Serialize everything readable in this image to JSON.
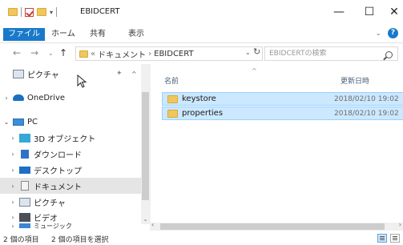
{
  "window": {
    "title": "EBIDCERT",
    "min": "—",
    "max": "☐",
    "close": "✕"
  },
  "ribbon": {
    "file": "ファイル",
    "home": "ホーム",
    "share": "共有",
    "view": "表示",
    "collapse": "⌄",
    "help": "?"
  },
  "address": {
    "back": "←",
    "forward": "→",
    "recent": "⌄",
    "up": "↑",
    "overflow": "«",
    "crumbs": [
      "ドキュメント",
      "EBIDCERT"
    ],
    "dropdown": "⌄",
    "refresh": "↻",
    "search_placeholder": "EBIDCERTの検索"
  },
  "nav": {
    "items": [
      {
        "label": "ピクチャ",
        "icon": "pictures-icon",
        "arrow": "",
        "pinned": true
      },
      {
        "label": "OneDrive",
        "icon": "onedrive-icon",
        "arrow": "›"
      },
      {
        "label": "PC",
        "icon": "pc-icon",
        "arrow": "⌄"
      },
      {
        "label": "3D オブジェクト",
        "icon": "3d-objects-icon",
        "arrow": "›"
      },
      {
        "label": "ダウンロード",
        "icon": "downloads-icon",
        "arrow": "›"
      },
      {
        "label": "デスクトップ",
        "icon": "desktop-icon",
        "arrow": "›"
      },
      {
        "label": "ドキュメント",
        "icon": "documents-icon",
        "arrow": "›",
        "selected": true
      },
      {
        "label": "ピクチャ",
        "icon": "pictures-icon",
        "arrow": "›"
      },
      {
        "label": "ビデオ",
        "icon": "videos-icon",
        "arrow": "›"
      },
      {
        "label": "ミュージック",
        "icon": "music-icon",
        "arrow": "›"
      }
    ],
    "pin": "✦",
    "collapse": "^"
  },
  "content": {
    "headers": {
      "name": "名前",
      "date": "更新日時"
    },
    "sort": "^",
    "files": [
      {
        "name": "keystore",
        "date": "2018/02/10 19:02"
      },
      {
        "name": "properties",
        "date": "2018/02/10 19:02"
      }
    ]
  },
  "status": {
    "count": "2 個の項目",
    "selected": "2 個の項目を選択"
  },
  "colors": {
    "accent": "#1979ca",
    "selection": "#cce8ff",
    "folder": "#f0c75e"
  }
}
